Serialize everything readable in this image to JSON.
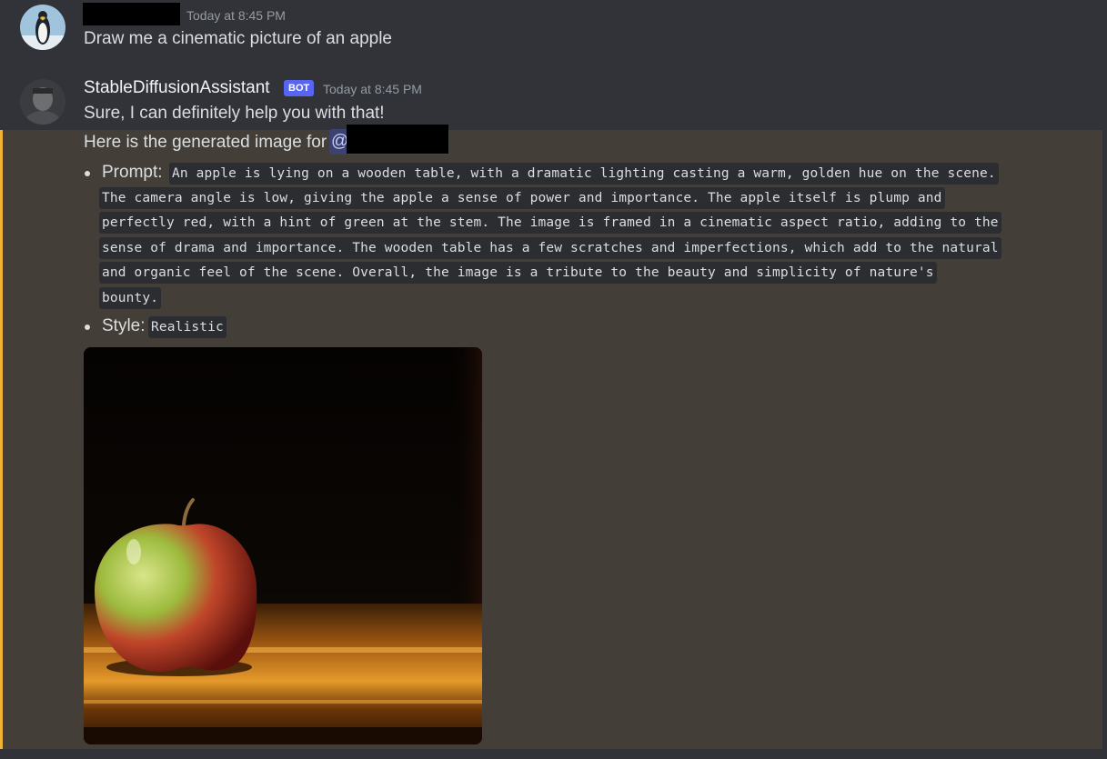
{
  "messages": [
    {
      "author": "",
      "timestamp": "Today at 8:45 PM",
      "text": "Draw me a cinematic picture of an apple",
      "avatar_icon": "penguin-avatar"
    },
    {
      "author": "StableDiffusionAssistant",
      "badge": "BOT",
      "timestamp": "Today at 8:45 PM",
      "text": "Sure, I can definitely help you with that!",
      "avatar_icon": "bot-avatar"
    }
  ],
  "generated": {
    "intro": "Here is the generated image for",
    "mention": "@",
    "prompt_label": "Prompt:",
    "prompt_lines": [
      "An apple is lying on a wooden table, with a dramatic lighting casting a warm, golden hue on the scene.",
      "The camera angle is low, giving the apple a sense of power and importance. The apple itself is plump and",
      "perfectly red, with a hint of green at the stem. The image is framed in a cinematic aspect ratio, adding to the",
      "sense of drama and importance. The wooden table has a few scratches and imperfections, which add to the natural",
      "and organic feel of the scene. Overall, the image is a tribute to the beauty and simplicity of nature's",
      "bounty."
    ],
    "style_label": "Style:",
    "style_value": "Realistic",
    "image_icon": "generated-apple-image"
  },
  "colors": {
    "background": "#313338",
    "highlight": "#433f38",
    "highlight_bar": "#f0b232",
    "bot_badge": "#5865f2"
  }
}
